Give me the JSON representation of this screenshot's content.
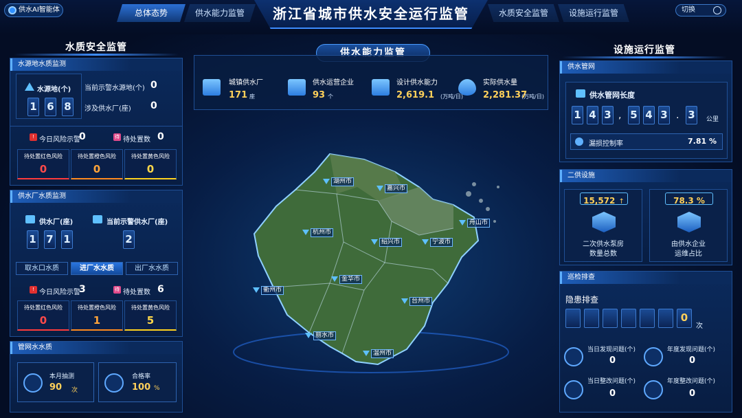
{
  "header": {
    "logo_text": "供水AI智能体",
    "title": "浙江省城市供水安全运行监管",
    "nav_left": [
      {
        "label": "总体态势",
        "active": true
      },
      {
        "label": "供水能力监管",
        "active": false
      }
    ],
    "nav_right": [
      {
        "label": "水质安全监管",
        "active": false
      },
      {
        "label": "设施运行监管",
        "active": false
      }
    ],
    "switch_label": "切换",
    "logout_icon": "logout-icon"
  },
  "left": {
    "section_title": "水质安全监管",
    "source": {
      "subhead": "水源地水质监测",
      "count_label": "水源地(个)",
      "digits": [
        "1",
        "6",
        "8"
      ],
      "alert_sources_label": "当前示警水源地(个)",
      "alert_sources_value": "0",
      "plants_involved_label": "涉及供水厂(座)",
      "plants_involved_value": "0",
      "today_alert_label": "今日风险示警",
      "today_alert_value": "0",
      "pending_label": "待处置数",
      "pending_value": "0",
      "risks": [
        {
          "label": "待处置红色风险",
          "value": "0"
        },
        {
          "label": "待处置橙色风险",
          "value": "0"
        },
        {
          "label": "待处置黄色风险",
          "value": "0"
        }
      ]
    },
    "plant": {
      "subhead": "供水厂水质监测",
      "count_label": "供水厂(座)",
      "digits": [
        "1",
        "7",
        "1"
      ],
      "alert_label": "当前示警供水厂(座)",
      "alert_digit": "2",
      "tabs": [
        {
          "label": "取水口水质",
          "active": false
        },
        {
          "label": "进厂水水质",
          "active": true
        },
        {
          "label": "出厂水水质",
          "active": false
        }
      ],
      "today_alert_label": "今日风险示警",
      "today_alert_value": "3",
      "pending_label": "待处置数",
      "pending_value": "6",
      "risks": [
        {
          "label": "待处置红色风险",
          "value": "0"
        },
        {
          "label": "待处置橙色风险",
          "value": "1"
        },
        {
          "label": "待处置黄色风险",
          "value": "5"
        }
      ]
    },
    "network": {
      "subhead": "管网水水质",
      "sample_label": "本月抽测",
      "sample_value": "90",
      "sample_unit": "次",
      "pass_label": "合格率",
      "pass_value": "100",
      "pass_unit": "%"
    }
  },
  "center": {
    "section_title": "供水能力监管",
    "stats": [
      {
        "label": "城镇供水厂",
        "value": "171",
        "unit": "座",
        "icon": "factory-icon"
      },
      {
        "label": "供水运营企业",
        "value": "93",
        "unit": "个",
        "icon": "building-icon"
      },
      {
        "label": "设计供水能力",
        "value": "2,619.1",
        "unit": "(万吨/日)",
        "icon": "plant-capacity-icon"
      },
      {
        "label": "实际供水量",
        "value": "2,281.37",
        "unit": "(万吨/日)",
        "icon": "water-drop-icon"
      }
    ],
    "cities": [
      "湖州市",
      "嘉兴市",
      "舟山市",
      "杭州市",
      "绍兴市",
      "宁波市",
      "衢州市",
      "金华市",
      "台州市",
      "丽水市",
      "温州市"
    ]
  },
  "right": {
    "section_title": "设施运行监管",
    "network": {
      "subhead": "供水管网",
      "length_label": "供水管网长度",
      "length_digits": [
        "1",
        "4",
        "3",
        ",",
        "5",
        "4",
        "3",
        ".",
        "3"
      ],
      "length_unit": "公里",
      "leak_label": "漏损控制率",
      "leak_value": "7.81 %"
    },
    "secondary": {
      "subhead": "二供设施",
      "pump_value": "15,572",
      "pump_trend": "↑",
      "pump_label_1": "二次供水泵房",
      "pump_label_2": "数量总数",
      "ratio_value": "78.3 %",
      "ratio_label_1": "由供水企业",
      "ratio_label_2": "运维占比"
    },
    "inspection": {
      "subhead": "巡检排查",
      "hazard_label": "隐患排查",
      "hazard_digits": [
        "",
        "",
        "",
        "",
        "",
        "",
        "0"
      ],
      "hazard_unit": "次",
      "items": [
        {
          "label": "当日发现问题(个)",
          "value": "0",
          "icon": "search-doc-icon"
        },
        {
          "label": "年度发现问题(个)",
          "value": "0",
          "icon": "person-icon"
        },
        {
          "label": "当日整改问题(个)",
          "value": "0",
          "icon": "checklist-icon"
        },
        {
          "label": "年度整改问题(个)",
          "value": "0",
          "icon": "pie-icon"
        }
      ]
    }
  }
}
